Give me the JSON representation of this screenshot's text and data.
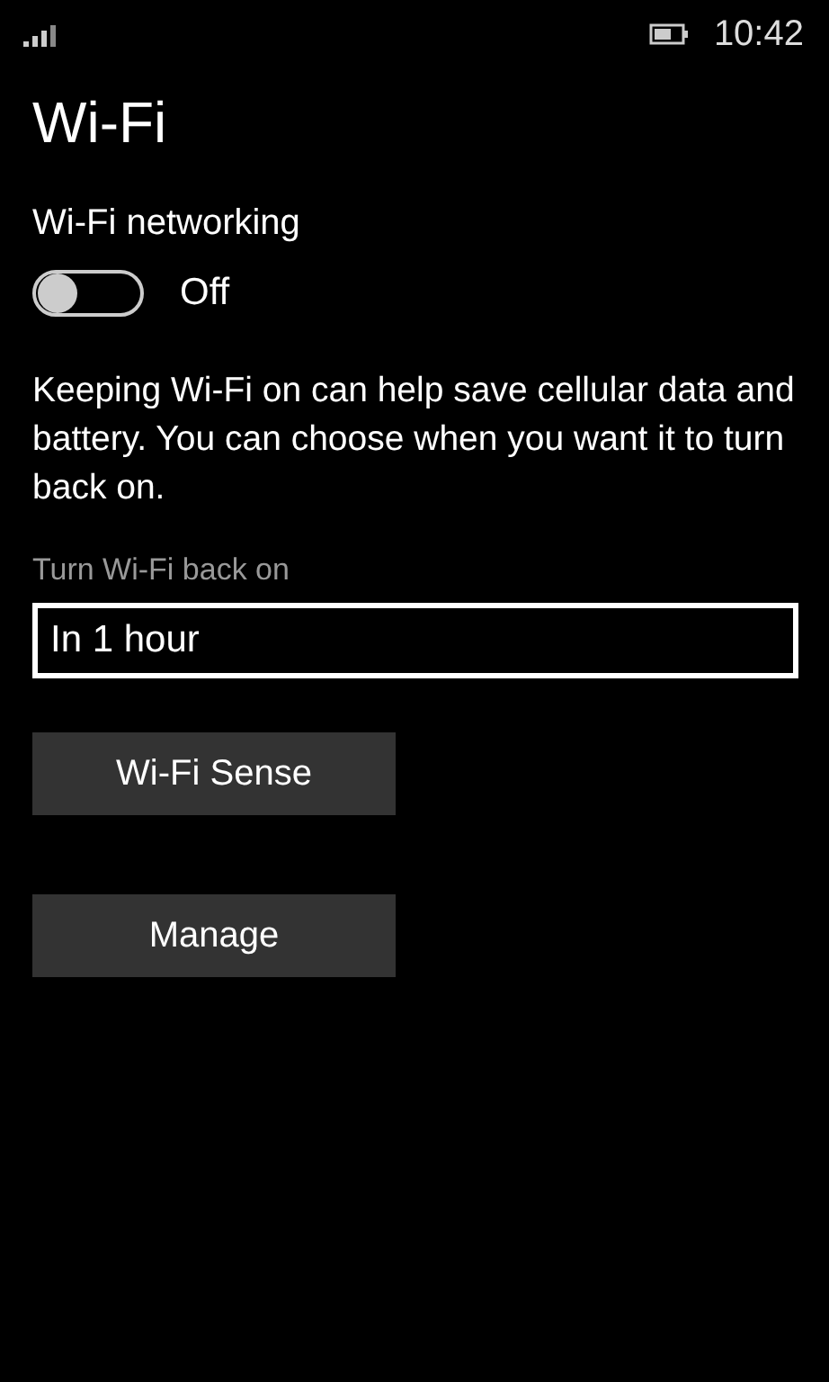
{
  "status_bar": {
    "time": "10:42"
  },
  "title": "Wi-Fi",
  "wifi_networking": {
    "label": "Wi-Fi networking",
    "on": false,
    "state_text": "Off"
  },
  "description": "Keeping Wi-Fi on can help save cellular data and battery. You can choose when you want it to turn back on.",
  "turn_back_on": {
    "label": "Turn Wi-Fi back on",
    "value": "In 1 hour"
  },
  "buttons": [
    "Wi-Fi Sense",
    "Manage"
  ]
}
